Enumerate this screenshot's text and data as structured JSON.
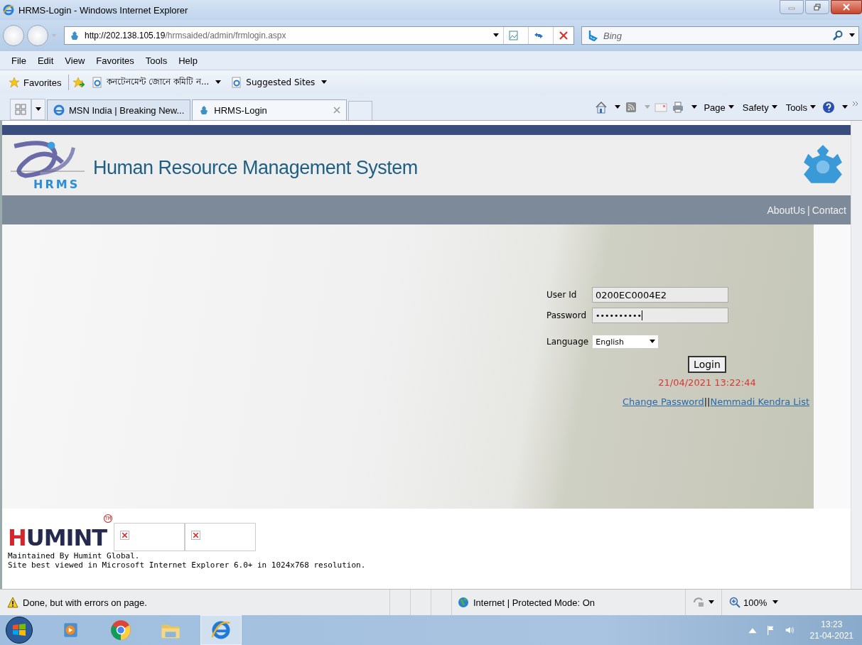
{
  "window": {
    "title": "HRMS-Login - Windows Internet Explorer"
  },
  "address_bar": {
    "host": "http://202.138.105.19",
    "path": "/hrmsaided/admin/frmlogin.aspx"
  },
  "search": {
    "placeholder": "Bing"
  },
  "menu": [
    "File",
    "Edit",
    "View",
    "Favorites",
    "Tools",
    "Help"
  ],
  "favorites_bar": {
    "label": "Favorites",
    "items": [
      {
        "label": "কনটেনমেন্ট জোনে কমিটি ন...",
        "kind": "page"
      },
      {
        "label": "Suggested Sites",
        "kind": "page"
      }
    ]
  },
  "tabs": [
    {
      "label": "MSN India | Breaking New...",
      "selected": false
    },
    {
      "label": "HRMS-Login",
      "selected": true
    }
  ],
  "command_bar": [
    "Page",
    "Safety",
    "Tools"
  ],
  "page": {
    "logo_text": "HRMS",
    "title": "Human Resource Management System",
    "nav_links": [
      "AboutUs",
      "Contact"
    ],
    "nav_separator": "|",
    "login": {
      "fields": [
        {
          "label": "User Id",
          "value": "0200EC0004E2",
          "kind": "text"
        },
        {
          "label": "Password",
          "value": "••••••••••",
          "kind": "password"
        }
      ],
      "language": {
        "label": "Language",
        "value": "English"
      },
      "button": "Login",
      "datetime": "21/04/2021 13:22:44",
      "links": [
        "Change Password",
        "Nemmadi Kendra List"
      ],
      "link_separator": "||"
    },
    "footer": {
      "brand": "HUMINT",
      "trademark": "TM",
      "lines": [
        "Maintained By Humint Global.",
        "Site best viewed in Microsoft Internet Explorer 6.0+ in 1024x768 resolution."
      ]
    }
  },
  "status_bar": {
    "message": "Done, but with errors on page.",
    "zone": "Internet | Protected Mode: On",
    "zoom": "100%"
  },
  "taskbar": {
    "time": "13:23",
    "date": "21-04-2021"
  }
}
